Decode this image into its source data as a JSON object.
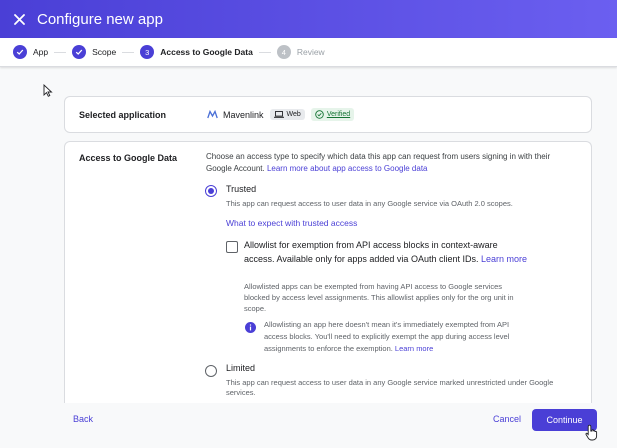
{
  "header": {
    "title": "Configure new app"
  },
  "steps": [
    {
      "number": "1",
      "label": "App",
      "state": "done"
    },
    {
      "number": "2",
      "label": "Scope",
      "state": "done"
    },
    {
      "number": "3",
      "label": "Access to Google Data",
      "state": "active"
    },
    {
      "number": "4",
      "label": "Review",
      "state": "future"
    }
  ],
  "selected_app": {
    "label": "Selected application",
    "name": "Mavenlink",
    "type_chip": "Web",
    "verified_chip": "Verified"
  },
  "access": {
    "label": "Access to Google Data",
    "description": "Choose an access type to specify which data this app can request from users signing in with their Google Account.",
    "learn_more_link": "Learn more about app access to Google data",
    "trusted": {
      "label": "Trusted",
      "description": "This app can request access to user data in any Google service via OAuth 2.0 scopes.",
      "expect_link": "What to expect with trusted access",
      "checkbox_label": "Allowlist for exemption from API access blocks in context-aware access. Available only for apps added via OAuth client IDs.",
      "checkbox_learn_more": "Learn more",
      "checkbox_description": "Allowlisted apps can be exempted from having API access to Google services blocked by access level assignments. This allowlist applies only for the org unit in scope.",
      "info_text": "Allowlisting an app here doesn't mean it's immediately exempted from API access blocks. You'll need to explicitly exempt the app during access level assignments to enforce the exemption.",
      "info_learn_more": "Learn more"
    },
    "limited": {
      "label": "Limited",
      "description": "This app can request access to user data in any Google service marked unrestricted under Google services."
    }
  },
  "footer": {
    "back": "Back",
    "cancel": "Cancel",
    "continue": "Continue"
  },
  "colors": {
    "accent": "#4a3fd6",
    "verified": "#137333"
  }
}
